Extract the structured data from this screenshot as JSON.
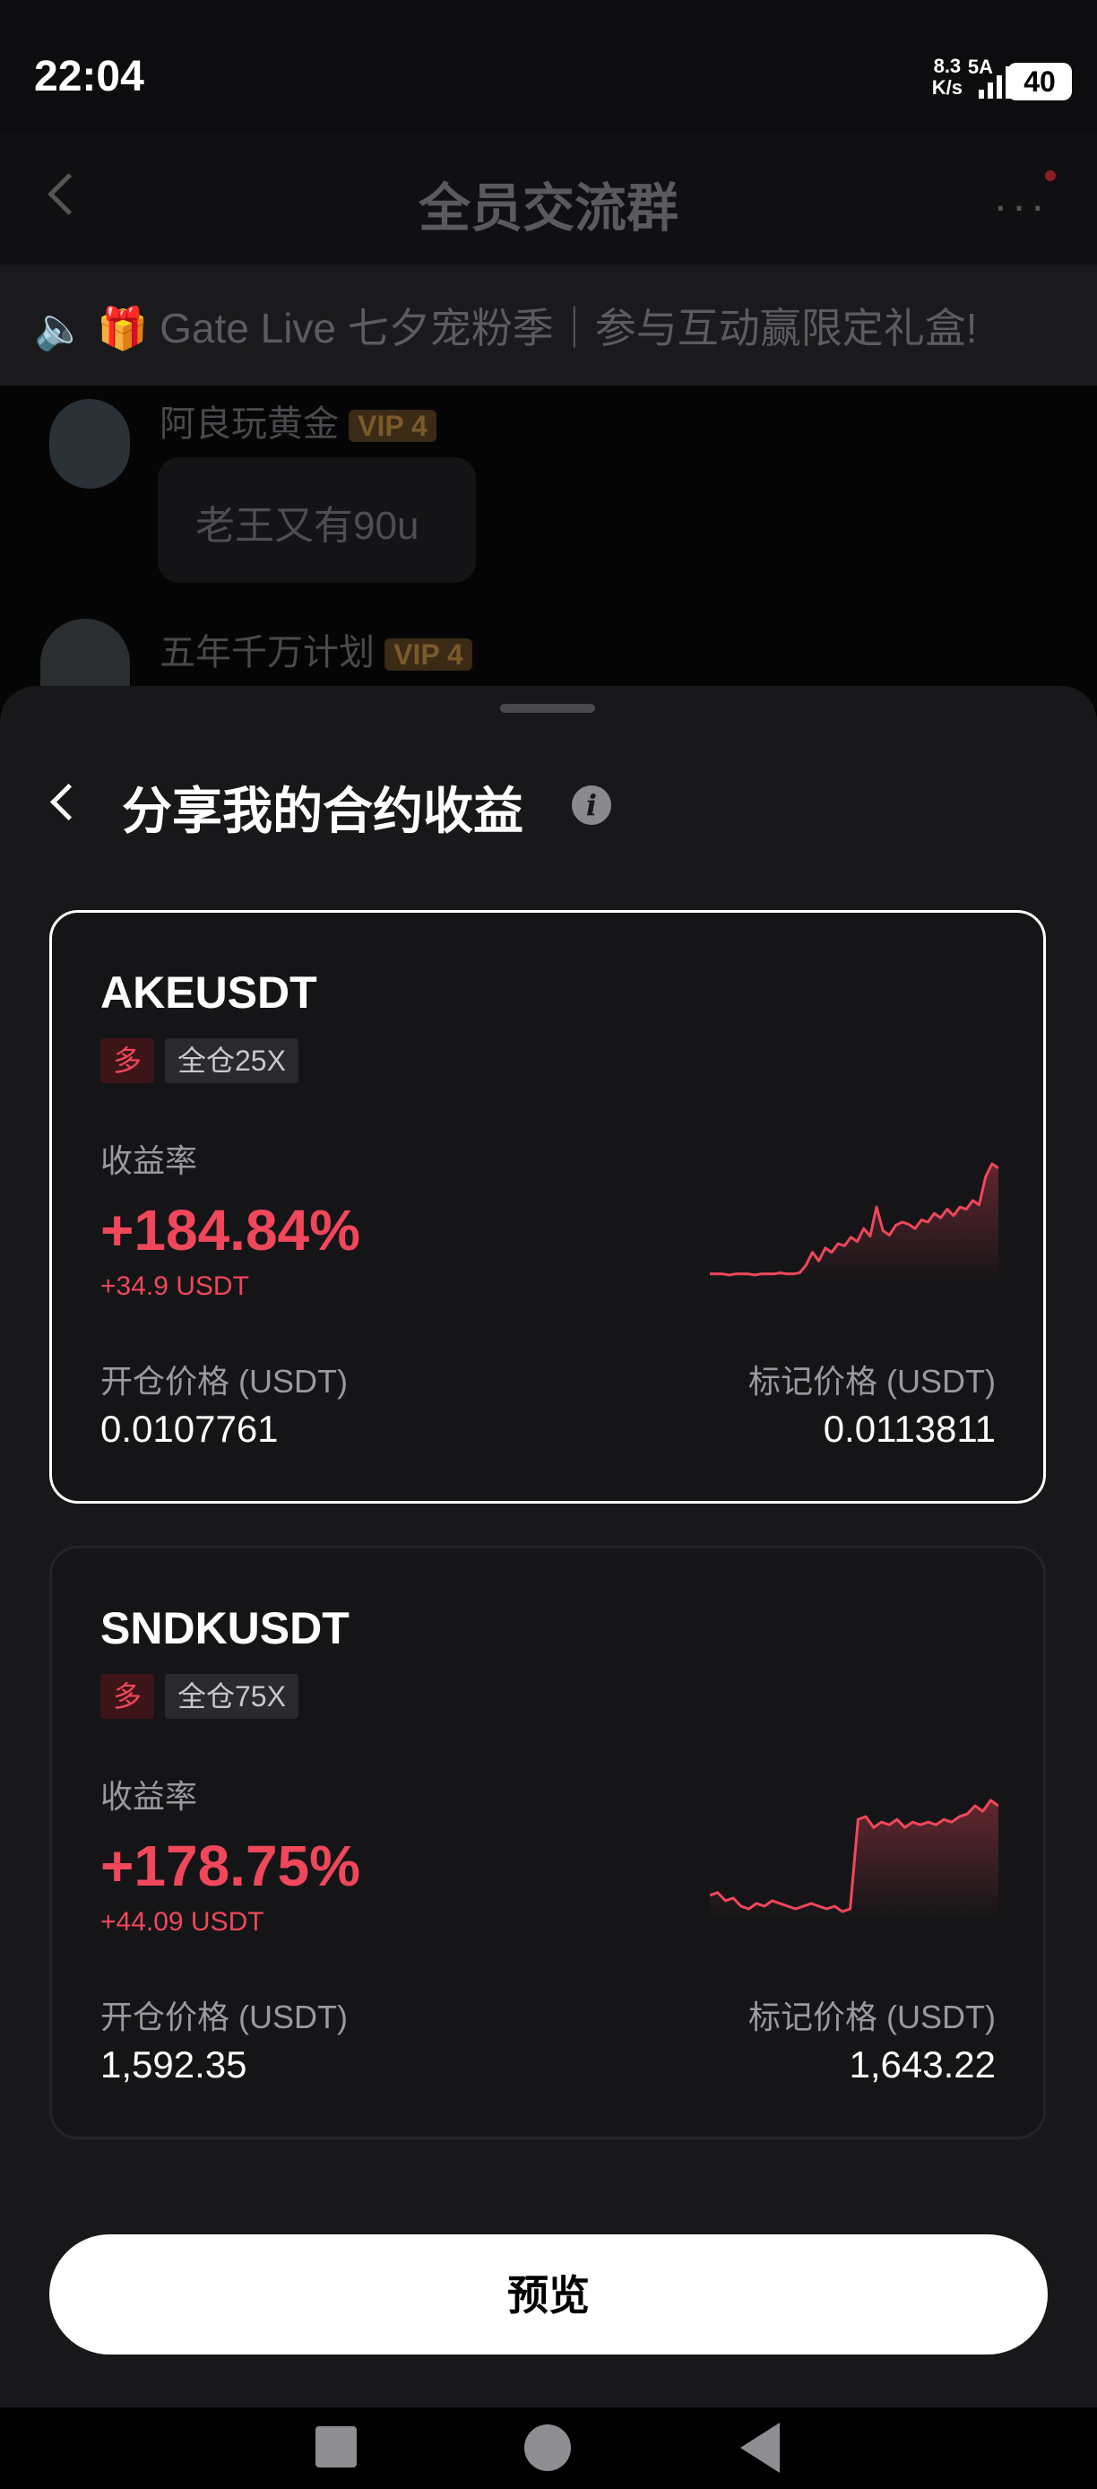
{
  "status_bar": {
    "time": "22:04",
    "net_speed_value": "8.3",
    "net_speed_unit": "K/s",
    "signal": "5A",
    "battery": "40"
  },
  "chat": {
    "title": "全员交流群",
    "announcement": "🔈 🎁 Gate Live 七夕宠粉季｜参与互动赢限定礼盒!",
    "messages": [
      {
        "user": "阿良玩黄金",
        "vip": "VIP 4",
        "text": "老王又有90u"
      },
      {
        "user": "五年千万计划",
        "vip": "VIP 4"
      }
    ]
  },
  "sheet": {
    "title": "分享我的合约收益",
    "info_icon": "i",
    "cards": [
      {
        "symbol": "AKEUSDT",
        "direction": "多",
        "leverage": "全仓25X",
        "yield_label": "收益率",
        "yield": "+184.84%",
        "pnl": "+34.9 USDT",
        "entry_label": "开仓价格 (USDT)",
        "entry_price": "0.0107761",
        "mark_label": "标记价格 (USDT)",
        "mark_price": "0.0113811",
        "selected": true,
        "sparkline": [
          10,
          10,
          10,
          9,
          10,
          10,
          10,
          9,
          10,
          10,
          10,
          11,
          10,
          10,
          11,
          18,
          30,
          22,
          34,
          30,
          38,
          36,
          44,
          40,
          52,
          45,
          72,
          50,
          46,
          55,
          58,
          56,
          52,
          60,
          58,
          66,
          62,
          70,
          64,
          72,
          70,
          78,
          74,
          100,
          112,
          108
        ]
      },
      {
        "symbol": "SNDKUSDT",
        "direction": "多",
        "leverage": "全仓75X",
        "yield_label": "收益率",
        "yield": "+178.75%",
        "pnl": "+44.09 USDT",
        "entry_label": "开仓价格 (USDT)",
        "entry_price": "1,592.35",
        "mark_label": "标记价格 (USDT)",
        "mark_price": "1,643.22",
        "selected": false,
        "sparkline": [
          30,
          32,
          26,
          28,
          22,
          20,
          24,
          22,
          26,
          24,
          22,
          20,
          22,
          24,
          22,
          20,
          22,
          18,
          20,
          86,
          88,
          80,
          84,
          82,
          86,
          80,
          84,
          82,
          84,
          82,
          86,
          84,
          88,
          90,
          96,
          92,
          100,
          96
        ]
      }
    ],
    "preview_label": "预览"
  },
  "colors": {
    "accent_red": "#f0475a",
    "sheet_bg": "#18181b",
    "card_bg": "#151517"
  },
  "icons": [
    "back-icon",
    "more-icon",
    "speaker-icon",
    "gift-icon",
    "info-icon",
    "nav-recents-icon",
    "nav-home-icon",
    "nav-back-icon"
  ]
}
